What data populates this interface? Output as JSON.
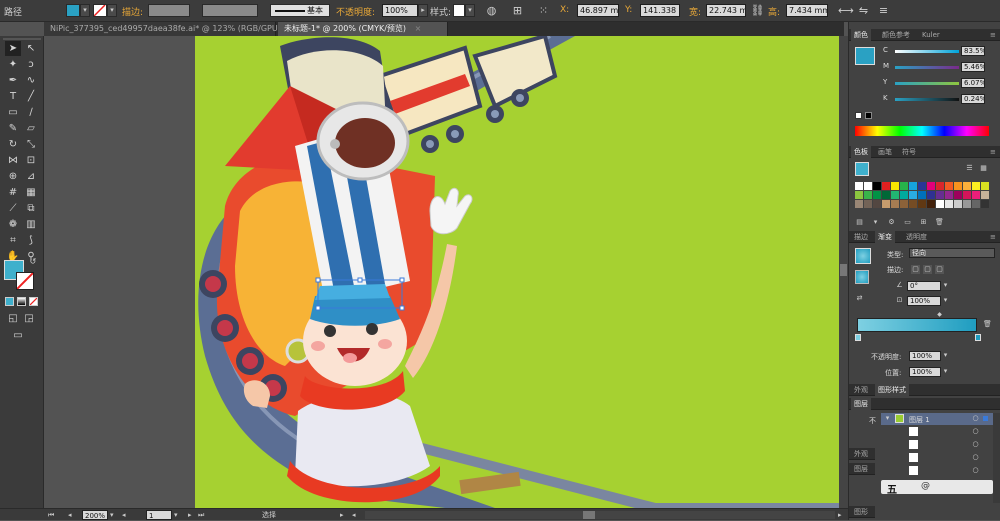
{
  "control_bar": {
    "mode_label": "路径",
    "stroke_label": "描边:",
    "stroke_style": "基本",
    "opacity_label": "不透明度:",
    "opacity_value": "100%",
    "style_label": "样式:",
    "x_label": "X:",
    "x_value": "46.897 mm",
    "y_label": "Y:",
    "y_value": "141.338 m",
    "w_label": "宽:",
    "w_value": "22.743 mm",
    "h_label": "高:",
    "h_value": "7.434 mm"
  },
  "document_tabs": [
    {
      "label": "NiPic_377395_ced49957daea38fe.ai* @ 123% (RGB/GPU 预览)",
      "active": false
    },
    {
      "label": "未标题-1* @ 200% (CMYK/预览)",
      "active": true
    }
  ],
  "color_panel": {
    "tabs": [
      "颜色",
      "颜色参考",
      "Kuler"
    ],
    "fill_color": "#2aa1c3",
    "channels": [
      {
        "label": "C",
        "value": "83.5%"
      },
      {
        "label": "M",
        "value": "5.46%"
      },
      {
        "label": "Y",
        "value": "6.07%"
      },
      {
        "label": "K",
        "value": "0.24%"
      }
    ]
  },
  "swatches_panel": {
    "tabs": [
      "色板",
      "画笔",
      "符号"
    ]
  },
  "gradient_panel": {
    "tabs": [
      "描边",
      "渐变",
      "透明度"
    ],
    "type_label": "类型:",
    "type_value": "径向",
    "stroke_label": "描边:",
    "angle_value": "0°",
    "aspect_value": "100%",
    "opacity_label": "不透明度:",
    "opacity_value": "100%",
    "location_label": "位置:",
    "location_value": "100%",
    "gradient_start": "#7ed0e2",
    "gradient_end": "#1f9dc0"
  },
  "appearance_panel": {
    "tabs": [
      "外观",
      "图形样式"
    ]
  },
  "layers_panel": {
    "tab": "图层",
    "layer_name": "图层 1",
    "short_label": "不",
    "sub_tabs": [
      "外观",
      "图层",
      "图形"
    ]
  },
  "status_bar": {
    "zoom": "200%",
    "page": "1",
    "mode": "选择"
  },
  "canvas": {
    "background": "#a6d131"
  },
  "watermark": {
    "text": "五",
    "site": "@"
  }
}
